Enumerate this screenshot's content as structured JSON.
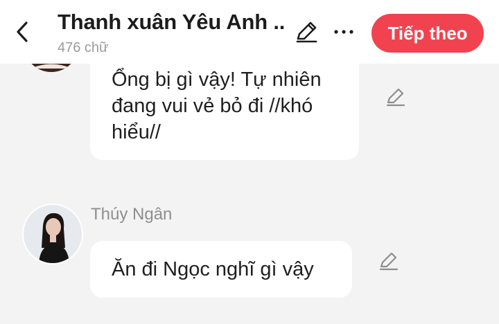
{
  "header": {
    "title": "Thanh xuân Yêu Anh ...",
    "word_count": "476 chữ",
    "next_label": "Tiếp theo",
    "accent_color": "#f0434f",
    "icons": {
      "back": "chevron-left-icon",
      "edit": "pencil-icon",
      "more": "more-horizontal-icon"
    }
  },
  "messages": [
    {
      "sender": "",
      "avatar": "avatar",
      "lines": [
        "Ổng bị gì vậy! Tự nhiên",
        "đang vui vẻ bỏ đi //khó",
        "hiểu//"
      ],
      "action_icon": "pencil-icon"
    },
    {
      "sender": "Thúy Ngân",
      "avatar": "avatar",
      "lines": [
        "Ăn đi Ngọc nghĩ gì vậy"
      ],
      "action_icon": "pencil-icon"
    }
  ]
}
